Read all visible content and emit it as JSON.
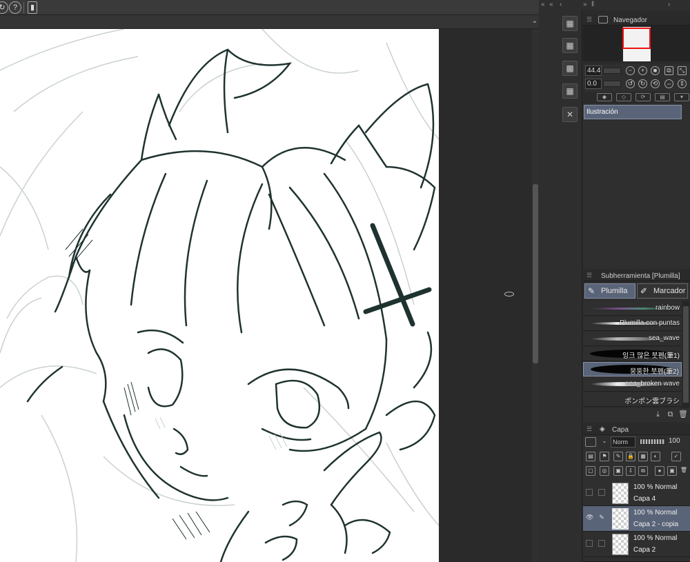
{
  "toolbar": {
    "icons": [
      "sync-icon",
      "help-icon",
      "phone-icon"
    ]
  },
  "dock": {
    "topbar_icons": [
      "collapse-left-icon",
      "collapse-left-icon",
      "chevron-left-icon",
      "collapse-right-icon",
      "chevron-right-icon"
    ]
  },
  "navigator": {
    "title": "Navegador",
    "zoom": "44.4",
    "rotation": "0.0"
  },
  "tool_panel": {
    "selected_tool": "Ilustración"
  },
  "subtool": {
    "title": "Subherramienta [Plumilla]",
    "tabs": [
      "Plumilla",
      "Marcador"
    ],
    "brushes": [
      {
        "label": "rainbow",
        "active": false
      },
      {
        "label": "Plumilla con puntas",
        "active": false
      },
      {
        "label": "sea_wave",
        "active": false
      },
      {
        "label": "잉크 많은 붓펜(筆1)",
        "active": false
      },
      {
        "label": "뭉뚱한 붓펜(筆2)",
        "active": true
      },
      {
        "label": "sea_broken wave",
        "active": false
      },
      {
        "label": "ポンポン雲ブラシ",
        "active": false
      }
    ]
  },
  "layers": {
    "title": "Capa",
    "blend_mode": "Norm",
    "opacity": "100",
    "items": [
      {
        "mode": "100 % Normal",
        "name": "Capa 4",
        "active": false,
        "visible": false
      },
      {
        "mode": "100 % Normal",
        "name": "Capa 2 - copia",
        "active": true,
        "visible": true
      },
      {
        "mode": "100 % Normal",
        "name": "Capa 2",
        "active": false,
        "visible": false
      }
    ]
  },
  "colors": {
    "accent": "#5a6478",
    "line_art": "#1e3330",
    "sketch": "#c9d1cf"
  }
}
